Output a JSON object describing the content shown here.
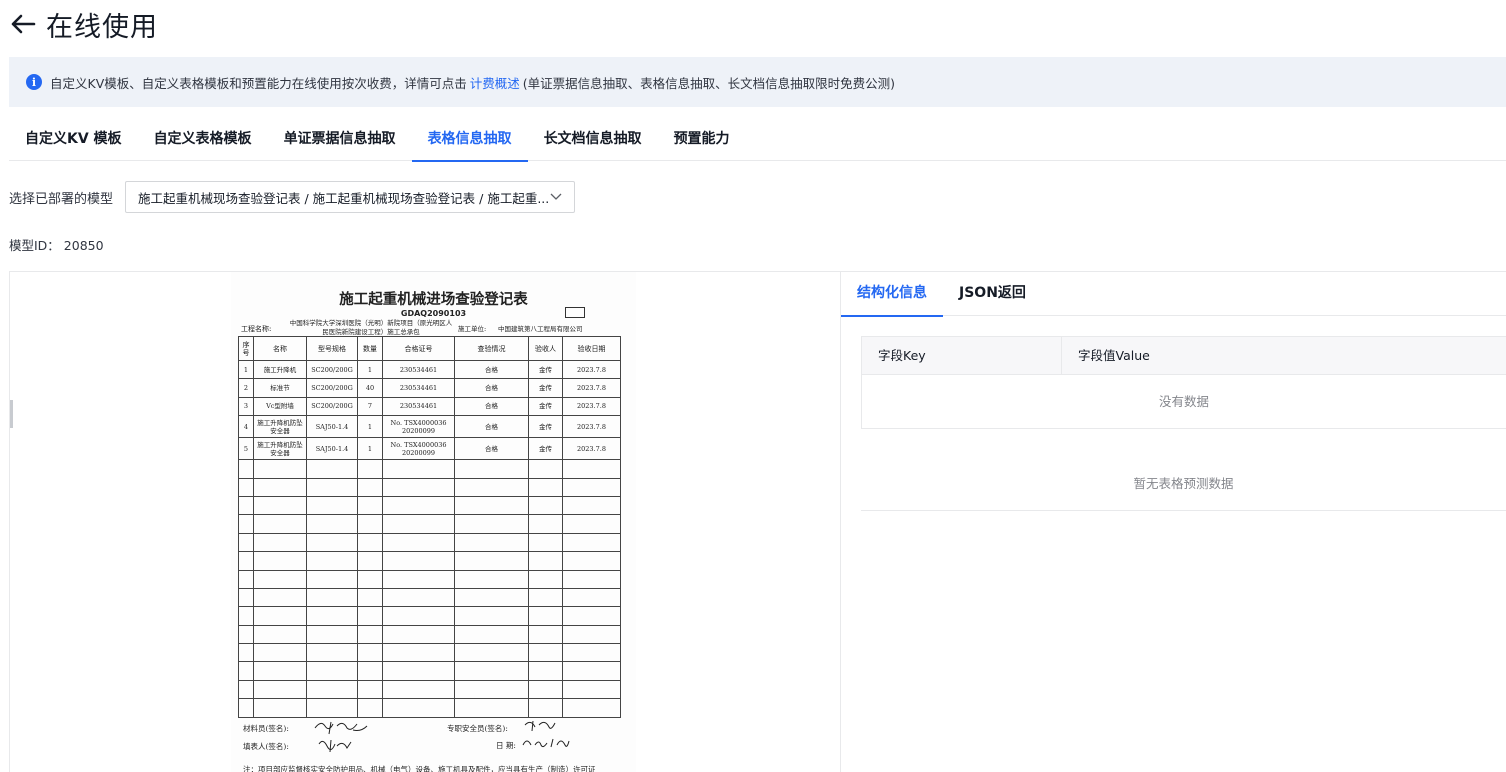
{
  "header": {
    "title": "在线使用",
    "back_icon": "arrow-left-icon"
  },
  "notice": {
    "icon": "info-icon",
    "text_before": "自定义KV模板、自定义表格模板和预置能力在线使用按次收费，详情可点击",
    "link": "计费概述",
    "text_after": "(单证票据信息抽取、表格信息抽取、长文档信息抽取限时免费公测)"
  },
  "tabs": [
    {
      "label": "自定义KV 模板",
      "active": false
    },
    {
      "label": "自定义表格模板",
      "active": false
    },
    {
      "label": "单证票据信息抽取",
      "active": false
    },
    {
      "label": "表格信息抽取",
      "active": true
    },
    {
      "label": "长文档信息抽取",
      "active": false
    },
    {
      "label": "预置能力",
      "active": false
    }
  ],
  "model": {
    "label": "选择已部署的模型",
    "selected": "施工起重机械现场查验登记表 / 施工起重机械现场查验登记表 / 施工起重...",
    "id_label": "模型ID：",
    "id_value": "20850"
  },
  "document": {
    "title": "施工起重机械进场查验登记表",
    "code": "GDAQ2090103",
    "project_label": "工程名称:",
    "project_name": "中国科学院大学深圳医院（光明）新院项目（原光明区人民医院新院建设工程）施工总承包",
    "unit_label": "施工单位:",
    "unit_value": "中国建筑第八工程局有限公司",
    "columns": [
      "序号",
      "名称",
      "型号规格",
      "数量",
      "合格证号",
      "查验情况",
      "验收人",
      "验收日期"
    ],
    "rows": [
      [
        "1",
        "施工升降机",
        "SC200/200G",
        "1",
        "230534461",
        "合格",
        "金传",
        "2023.7.8"
      ],
      [
        "2",
        "标准节",
        "SC200/200G",
        "40",
        "230534461",
        "合格",
        "金传",
        "2023.7.8"
      ],
      [
        "3",
        "Vc型附墙",
        "SC200/200G",
        "7",
        "230534461",
        "合格",
        "金传",
        "2023.7.8"
      ],
      [
        "4",
        "施工升降机防坠安全器",
        "SAJ50-1.4",
        "1",
        "No. TSX4000036 20200099",
        "合格",
        "金传",
        "2023.7.8"
      ],
      [
        "5",
        "施工升降机防坠安全器",
        "SAJ50-1.4",
        "1",
        "No. TSX4000036 20200099",
        "合格",
        "金传",
        "2023.7.8"
      ]
    ],
    "empty_rows": 14,
    "sign_material": "材料员(签名):",
    "sign_filler": "填表人(签名):",
    "sign_safety": "专职安全员(签名):",
    "sign_date_label": "日  期:",
    "note": "注：项目部应监督核实安全防护用品、机械（电气）设备、施工机具及配件，应当具有生产（制造）许可证"
  },
  "result": {
    "tabs": [
      {
        "label": "结构化信息",
        "active": true
      },
      {
        "label": "JSON返回",
        "active": false
      }
    ],
    "kv_headers": [
      "字段Key",
      "字段值Value"
    ],
    "kv_empty": "没有数据",
    "table_empty": "暂无表格预测数据"
  }
}
